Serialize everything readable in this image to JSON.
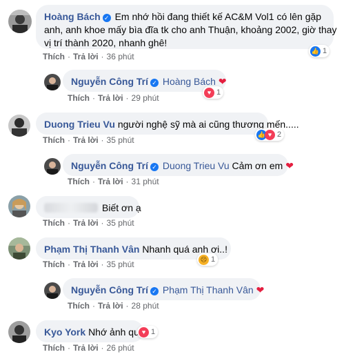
{
  "comments": [
    {
      "author": "Hoàng Bách",
      "text": "Em nhớ hồi đang thiết kế AC&M Vol1 có lên gặp anh, anh khoe mấy bìa đĩa tk cho anh Thuận, khoảng 2002, giờ thay vị trí thành 2020, nhanh ghê!",
      "line1": "Em nhớ hồi đang thiết kế AC&M Vol1 có lên gặp",
      "line2": "anh, anh khoe mấy bìa đĩa tk cho anh Thuận, khoảng 2002, giờ thay",
      "line3": "vị trí thành 2020, nhanh ghê!",
      "like": "Thích",
      "reply": "Trả lời",
      "time": "36 phút",
      "reaction_count": "1"
    },
    {
      "author": "Nguyễn Công Trí",
      "mention": "Hoàng Bách",
      "like": "Thích",
      "reply": "Trả lời",
      "time": "29 phút",
      "reaction_count": "1"
    },
    {
      "author": "Duong Trieu Vu",
      "text": "người nghệ sỹ mà ai cũng thương mến.....",
      "like": "Thích",
      "reply": "Trả lời",
      "time": "35 phút",
      "reaction_count": "2"
    },
    {
      "author": "Nguyễn Công Trí",
      "mention": "Duong Trieu Vu",
      "text": "Cảm ơn em",
      "like": "Thích",
      "reply": "Trả lời",
      "time": "31 phút"
    },
    {
      "text": "Biết ơn ạ",
      "like": "Thích",
      "reply": "Trả lời",
      "time": "35 phút"
    },
    {
      "author": "Phạm Thị Thanh Vân",
      "text": "Nhanh quá anh ơi..!",
      "like": "Thích",
      "reply": "Trả lời",
      "time": "35 phút",
      "reaction_count": "1"
    },
    {
      "author": "Nguyễn Công Trí",
      "mention": "Phạm Thị Thanh Vân",
      "like": "Thích",
      "reply": "Trả lời",
      "time": "28 phút"
    },
    {
      "author": "Kyo York",
      "text": "Nhớ ảnh quá",
      "like": "Thích",
      "reply": "Trả lời",
      "time": "26 phút",
      "reaction_count": "1"
    }
  ],
  "separator": "·",
  "colors": {
    "link": "#385898",
    "like_blue": "#1877f2",
    "love_red": "#f33e58",
    "bubble_bg": "#f0f2f5",
    "meta_gray": "#65676b"
  },
  "icons": [
    "verified-badge-icon",
    "like-reaction-icon",
    "love-reaction-icon",
    "sad-reaction-icon",
    "heart-emoji-icon"
  ]
}
